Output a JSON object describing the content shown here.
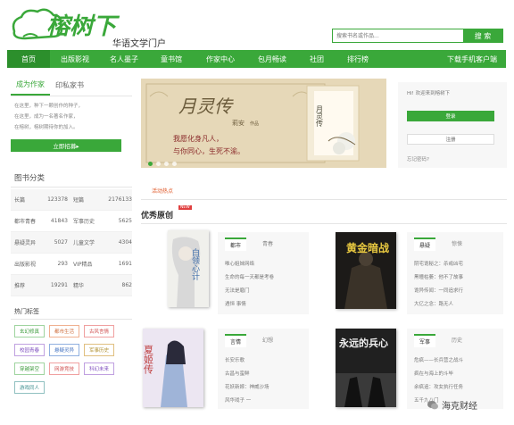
{
  "header": {
    "logo_text": "榕树下",
    "slogan": "华语文学门户"
  },
  "search": {
    "placeholder": "搜索书名或作品...",
    "button": "搜 索"
  },
  "nav": [
    "首页",
    "出版影视",
    "名人墨子",
    "童书馆",
    "作家中心",
    "包月畅读",
    "社团",
    "排行榜",
    "下载手机客户端"
  ],
  "left": {
    "tabs": [
      "成为作家",
      "印私家书"
    ],
    "promo_lines": [
      "在这里，种下一颗创作的种子，",
      "在这里，成为一名著名作家，",
      "在榕树，榕树期待你的加入。"
    ],
    "promo_button": "立即招募▸",
    "cat_title": "图书分类",
    "categories": [
      {
        "a": "长篇",
        "an": "123378",
        "b": "短篇",
        "bn": "2176133"
      },
      {
        "a": "都市青春",
        "an": "41843",
        "b": "军事历史",
        "bn": "5625"
      },
      {
        "a": "悬疑灵异",
        "an": "5027",
        "b": "儿童文学",
        "bn": "4304"
      },
      {
        "a": "出版影视",
        "an": "293",
        "b": "VIP精品",
        "bn": "1691"
      },
      {
        "a": "推荐",
        "an": "19291",
        "b": "精华",
        "bn": "862"
      }
    ],
    "tags_title": "热门标签",
    "tags": [
      "玄幻修真",
      "都市生活",
      "古风言情",
      "校园青春",
      "悬疑灵异",
      "军事历史",
      "穿越架空",
      "网游竞技",
      "科幻未来",
      "游戏同人"
    ]
  },
  "banner": {
    "title": "月灵传",
    "author": "莉安",
    "author_suffix": "作品",
    "slogan1": "我愿化身凡人，",
    "slogan2": "与你同心，生死不渝。",
    "book_title": "月灵传"
  },
  "login": {
    "welcome": "Hi! 欢迎来到榕树下",
    "login_button": "登录",
    "register_button": "注册",
    "forgot": "忘记密码?"
  },
  "hot_activity": "活动热点",
  "best_title": "优秀原创",
  "new_badge": "NEW",
  "books": [
    {
      "cover_title": "白领心计",
      "tabs": [
        "都市",
        "青春"
      ],
      "list": [
        "唯心姐妹网络",
        "生命的每一天都是考卷",
        "无法是磨门",
        "遇恒 事情"
      ]
    },
    {
      "cover_title": "黄金暗战",
      "tabs": [
        "悬疑",
        "惊悚"
      ],
      "list": [
        "阴宅诡秘之：杀戒凶宅",
        "黑瞳枯萎：他不了故事",
        "诡异传闻：一同追求行",
        "大亿之念：路无人"
      ]
    },
    {
      "cover_title": "夏姬传",
      "tabs": [
        "言情",
        "幻想"
      ],
      "list": [
        "长安乐歌",
        "古昌与蛮鲜",
        "花妖新嫁：神威沙场",
        "风华戏子 一"
      ]
    },
    {
      "cover_title": "永远的兵心",
      "tabs": [
        "军事",
        "历史"
      ],
      "list": [
        "危疯——长兵营之战斗",
        "疯在与海上的斗毕",
        "余疯追：攻女执行任务",
        "五千九八门"
      ]
    }
  ],
  "watermark": "海克财经"
}
